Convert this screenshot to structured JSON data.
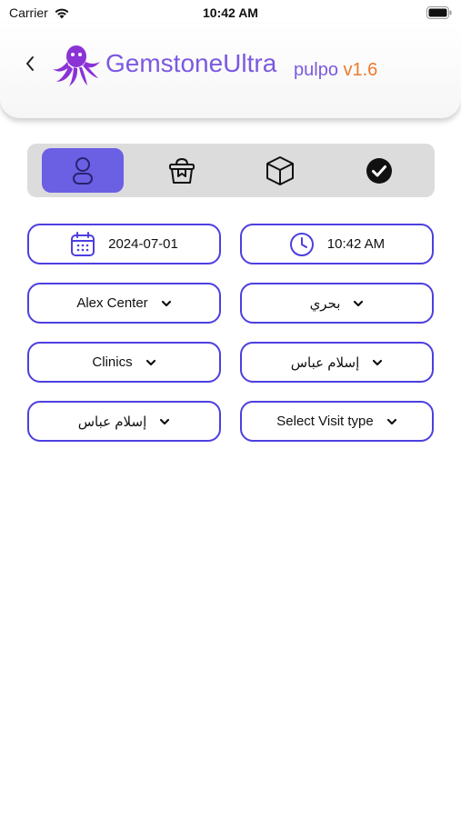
{
  "status": {
    "carrier": "Carrier",
    "time": "10:42 AM"
  },
  "header": {
    "app_name": "GemstoneUltra",
    "sub": "pulpo",
    "version": "v1.6"
  },
  "tabs": [
    {
      "icon": "person-icon",
      "active": true
    },
    {
      "icon": "basket-icon",
      "active": false
    },
    {
      "icon": "box-icon",
      "active": false
    },
    {
      "icon": "check-circle-icon",
      "active": false
    }
  ],
  "form": {
    "date": "2024-07-01",
    "time": "10:42 AM",
    "center": "Alex Center",
    "region": "بحري",
    "department": "Clinics",
    "person1": "إسلام عباس",
    "person2": "إسلام عباس",
    "visit_type": "Select Visit type"
  },
  "colors": {
    "accent": "#4d3fe0",
    "brand": "#7b59e0",
    "version": "#ee7a2c",
    "active_tab": "#6b5fe3"
  }
}
